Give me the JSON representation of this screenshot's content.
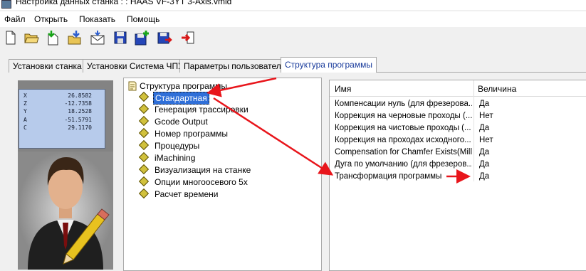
{
  "window": {
    "title": "Настройка данных станка : : HAAS VF-3YT 3-Axis.vmid"
  },
  "menu": [
    "Файл",
    "Открыть",
    "Показать",
    "Помощь"
  ],
  "toolbar": {
    "buttons": [
      "new-file-icon",
      "open-folder-icon",
      "import-icon",
      "download-icon",
      "email-icon",
      "save-icon",
      "save-add-icon",
      "save-as-icon",
      "exit-icon"
    ]
  },
  "tabs": [
    {
      "label": "Установки станка",
      "active": false
    },
    {
      "label": "Установки Система ЧПУ",
      "active": false
    },
    {
      "label": "Параметры пользователя",
      "active": false
    },
    {
      "label": "Структура программы",
      "active": true
    }
  ],
  "machine_display": {
    "rows": [
      {
        "axis": "X",
        "value": "26.8582"
      },
      {
        "axis": "Z",
        "value": "-12.7358"
      },
      {
        "axis": "Y",
        "value": "18.2528"
      },
      {
        "axis": "A",
        "value": "-51.5791"
      },
      {
        "axis": "C",
        "value": "29.1170"
      }
    ]
  },
  "tree": {
    "root": "Структура программы",
    "items": [
      {
        "label": "Стандартная",
        "selected": true
      },
      {
        "label": "Генерация трассировки",
        "selected": false
      },
      {
        "label": "Gcode Output",
        "selected": false
      },
      {
        "label": "Номер программы",
        "selected": false
      },
      {
        "label": "Процедуры",
        "selected": false
      },
      {
        "label": "iMachining",
        "selected": false
      },
      {
        "label": "Визуализация на станке",
        "selected": false
      },
      {
        "label": "Опции многоосевого 5x",
        "selected": false
      },
      {
        "label": "Расчет времени",
        "selected": false
      }
    ]
  },
  "grid": {
    "headers": {
      "name": "Имя",
      "value": "Величина"
    },
    "rows": [
      {
        "name": "Компенсации нуль (для фрезерова...",
        "value": "Да"
      },
      {
        "name": "Коррекция на черновые проходы (...",
        "value": "Нет"
      },
      {
        "name": "Коррекция на чистовые проходы (...",
        "value": "Да"
      },
      {
        "name": "Коррекция на проходах исходного...",
        "value": "Нет"
      },
      {
        "name": "Compensation for Chamfer Exists(Mill...",
        "value": "Да"
      },
      {
        "name": "Дуга по умолчанию (для фрезеров...",
        "value": "Да"
      },
      {
        "name": "Трансформация программы",
        "value": "Да"
      }
    ]
  },
  "colors": {
    "annotation_arrow": "#e8151b",
    "selection": "#2f6fd8",
    "tree_diamond": "#d1c13c",
    "lcd_background": "#b7cbeb"
  }
}
